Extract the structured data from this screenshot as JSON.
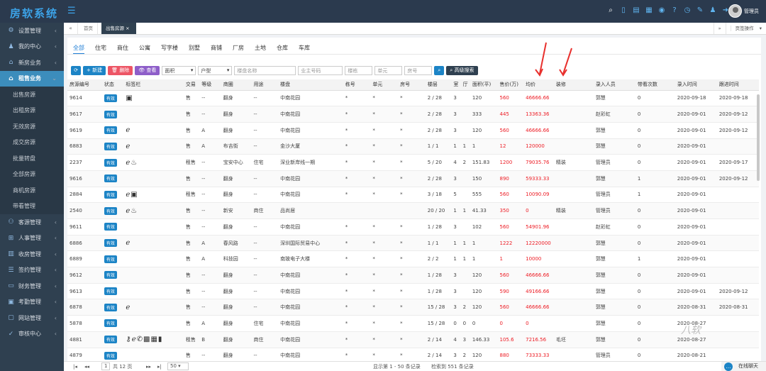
{
  "app": {
    "logo": "房软系统",
    "user": "管理员"
  },
  "sidebar": {
    "top": [
      {
        "label": "设置管理",
        "icon": "gear-icon"
      },
      {
        "label": "我的中心",
        "icon": "user-icon"
      },
      {
        "label": "新房业务",
        "icon": "house-icon"
      }
    ],
    "active": {
      "label": "租售业务",
      "icon": "house-icon"
    },
    "sub": [
      "出售房源",
      "出租房源",
      "无效房源",
      "成交房源",
      "批量转盘",
      "全部房源",
      "商机房源",
      "带看管理"
    ],
    "bottom": [
      {
        "label": "客源管理",
        "icon": "users-icon"
      },
      {
        "label": "人事管理",
        "icon": "org-icon"
      },
      {
        "label": "收房管理",
        "icon": "building-icon"
      },
      {
        "label": "签约管理",
        "icon": "list-icon"
      },
      {
        "label": "财务管理",
        "icon": "card-icon"
      },
      {
        "label": "考勤管理",
        "icon": "calendar-icon"
      },
      {
        "label": "网站管理",
        "icon": "monitor-icon"
      },
      {
        "label": "审核中心",
        "icon": "check-icon"
      }
    ]
  },
  "tabs": {
    "home": "首页",
    "current": "出售房源",
    "page_ops": "页签操作"
  },
  "subnav": [
    "全部",
    "住宅",
    "商住",
    "公寓",
    "写字楼",
    "别墅",
    "商铺",
    "厂房",
    "土地",
    "仓库",
    "车库"
  ],
  "toolbar": {
    "new": "新建",
    "delete": "删除",
    "view": "查看",
    "area_select": "面积",
    "type_select": "户型",
    "ph_estate": "楼盘名称",
    "ph_owner": "业主号码",
    "ph_building": "楼栋",
    "ph_unit": "单元",
    "ph_room": "房号",
    "advanced": "高级搜索"
  },
  "columns": [
    "房源编号",
    "状态",
    "标签栏",
    "交易",
    "等级",
    "商圈",
    "用途",
    "楼盘",
    "栋号",
    "单元",
    "房号",
    "楼层",
    "室",
    "厅",
    "面积(平)",
    "售价(万)",
    "均价",
    "装修",
    "录入人员",
    "带看次数",
    "录入时间",
    "跟进时间"
  ],
  "rows": [
    [
      "9614",
      "有效",
      "img",
      "售",
      "--",
      "翻身",
      "--",
      "中南花园",
      "*",
      "*",
      "*",
      "2 / 28",
      "3",
      "",
      "120",
      "560",
      "46666.66",
      "",
      "郭慧",
      "0",
      "2020-09-18",
      "2020-09-18"
    ],
    [
      "9617",
      "有效",
      "",
      "售",
      "--",
      "翻身",
      "--",
      "中南花园",
      "*",
      "*",
      "*",
      "2 / 28",
      "3",
      "",
      "333",
      "445",
      "13363.36",
      "",
      "赵彩虹",
      "0",
      "2020-09-01",
      "2020-09-12"
    ],
    [
      "9619",
      "有效",
      "ie",
      "售",
      "A",
      "翻身",
      "--",
      "中南花园",
      "*",
      "*",
      "*",
      "2 / 28",
      "3",
      "",
      "120",
      "560",
      "46666.66",
      "",
      "郭慧",
      "0",
      "2020-09-01",
      "2020-09-12"
    ],
    [
      "6883",
      "有效",
      "ie",
      "售",
      "A",
      "布吉街",
      "--",
      "金沙大厦",
      "*",
      "*",
      "*",
      "1 / 1",
      "1",
      "1",
      "1",
      "12",
      "120000",
      "",
      "郭慧",
      "0",
      "2020-09-01",
      ""
    ],
    [
      "2237",
      "有效",
      "ie-fire",
      "租售",
      "--",
      "宝安中心",
      "住宅",
      "深业新岸线一期",
      "*",
      "*",
      "*",
      "5 / 20",
      "4",
      "2",
      "151.83",
      "1200",
      "79035.76",
      "精装",
      "管理员",
      "0",
      "2020-09-01",
      "2020-09-17"
    ],
    [
      "9616",
      "有效",
      "",
      "售",
      "--",
      "翻身",
      "--",
      "中南花园",
      "*",
      "*",
      "*",
      "2 / 28",
      "3",
      "",
      "150",
      "890",
      "59333.33",
      "",
      "郭慧",
      "1",
      "2020-09-01",
      "2020-09-12"
    ],
    [
      "2884",
      "有效",
      "ie-img",
      "租售",
      "--",
      "翻身",
      "--",
      "中南花园",
      "*",
      "*",
      "*",
      "3 / 18",
      "5",
      "",
      "555",
      "560",
      "10090.09",
      "",
      "管理员",
      "1",
      "2020-09-01",
      ""
    ],
    [
      "2540",
      "有效",
      "ie-fire",
      "售",
      "--",
      "新安",
      "商住",
      "品尚居",
      "",
      "",
      "",
      "20 / 20",
      "1",
      "1",
      "41.33",
      "350",
      "0",
      "精装",
      "管理员",
      "0",
      "2020-09-01",
      ""
    ],
    [
      "9611",
      "有效",
      "",
      "售",
      "--",
      "翻身",
      "--",
      "中南花园",
      "*",
      "*",
      "*",
      "1 / 28",
      "3",
      "",
      "102",
      "560",
      "54901.96",
      "",
      "赵彩虹",
      "0",
      "2020-09-01",
      ""
    ],
    [
      "6886",
      "有效",
      "ie",
      "售",
      "A",
      "春风路",
      "--",
      "深圳国际贸易中心",
      "*",
      "*",
      "*",
      "1 / 1",
      "1",
      "1",
      "1",
      "1222",
      "12220000",
      "",
      "郭慧",
      "0",
      "2020-09-01",
      ""
    ],
    [
      "6889",
      "有效",
      "",
      "售",
      "A",
      "科技园",
      "--",
      "南玻电子大楼",
      "*",
      "*",
      "*",
      "2 / 2",
      "1",
      "1",
      "1",
      "1",
      "10000",
      "",
      "郭慧",
      "1",
      "2020-09-01",
      ""
    ],
    [
      "9612",
      "有效",
      "",
      "售",
      "--",
      "翻身",
      "--",
      "中南花园",
      "*",
      "*",
      "*",
      "1 / 28",
      "3",
      "",
      "120",
      "560",
      "46666.66",
      "",
      "郭慧",
      "0",
      "2020-09-01",
      ""
    ],
    [
      "9613",
      "有效",
      "",
      "售",
      "--",
      "翻身",
      "--",
      "中南花园",
      "*",
      "*",
      "*",
      "1 / 28",
      "3",
      "",
      "120",
      "590",
      "49166.66",
      "",
      "郭慧",
      "0",
      "2020-09-01",
      "2020-09-12"
    ],
    [
      "6878",
      "有效",
      "ie",
      "售",
      "--",
      "翻身",
      "--",
      "中南花园",
      "*",
      "*",
      "*",
      "15 / 28",
      "3",
      "2",
      "120",
      "560",
      "46666.66",
      "",
      "郭慧",
      "0",
      "2020-08-31",
      "2020-08-31"
    ],
    [
      "5878",
      "有效",
      "",
      "售",
      "A",
      "翻身",
      "住宅",
      "中南花园",
      "*",
      "*",
      "*",
      "15 / 28",
      "0",
      "0",
      "0",
      "0",
      "0",
      "",
      "郭慧",
      "0",
      "2020-08-27",
      ""
    ],
    [
      "4881",
      "有效",
      "many",
      "租售",
      "B",
      "翻身",
      "商住",
      "中南花园",
      "*",
      "*",
      "*",
      "2 / 14",
      "4",
      "3",
      "146.33",
      "105.6",
      "7216.56",
      "毛坯",
      "郭慧",
      "0",
      "2020-08-27",
      ""
    ],
    [
      "4879",
      "有效",
      "",
      "售",
      "--",
      "翻身",
      "--",
      "中南花园",
      "*",
      "*",
      "*",
      "2 / 14",
      "3",
      "2",
      "120",
      "880",
      "73333.33",
      "",
      "管理员",
      "0",
      "2020-08-21",
      ""
    ]
  ],
  "pager": {
    "page_input": "1",
    "total_pages": "共 12 页",
    "size": "50",
    "summary": "显示第 1 - 50 条记录",
    "count": "检索到 551 条记录"
  },
  "chat": {
    "label": "在线聊天"
  },
  "watermark": "八软",
  "colors": {
    "primary": "#1c84c6",
    "danger": "#ed5565",
    "purple": "#8e5ec9",
    "header": "#2b3a4e",
    "sidebar": "#2f4050",
    "price_red": "#ed1c24"
  }
}
